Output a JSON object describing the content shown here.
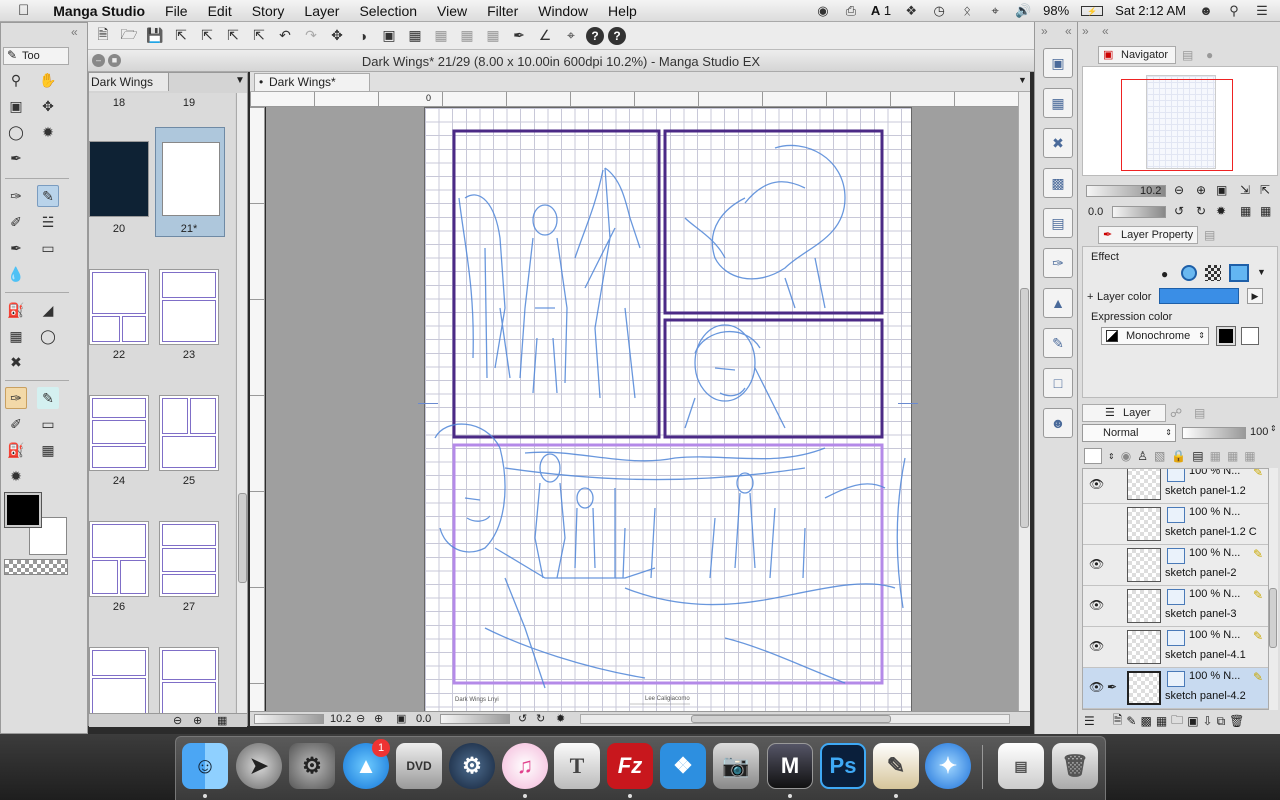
{
  "menubar": {
    "items": [
      "Manga Studio",
      "File",
      "Edit",
      "Story",
      "Layer",
      "Selection",
      "View",
      "Filter",
      "Window",
      "Help"
    ],
    "status": {
      "notifications": "1",
      "battery": "98%",
      "clock": "Sat 2:12 AM"
    }
  },
  "toolbox": {
    "title": "Too"
  },
  "story": {
    "tab": "Dark Wings",
    "pages": [
      "18",
      "19",
      "20",
      "21*",
      "22",
      "23",
      "24",
      "25",
      "26",
      "27"
    ]
  },
  "canvas": {
    "window_title": "Dark Wings* 21/29 (8.00 x 10.00in 600dpi 10.2%) - Manga Studio EX",
    "tab": "Dark Wings* 21/29",
    "ruler_zero": "0",
    "footer_left": "Dark Wings Lnyi",
    "footer_center": "Lee Caligiacomo",
    "zoom": "10.2",
    "rotation": "0.0"
  },
  "navigator": {
    "tab": "Navigator",
    "zoom": "10.2",
    "rotation": "0.0"
  },
  "layer_property": {
    "tab": "Layer Property",
    "effect_label": "Effect",
    "layer_color_label": "Layer color",
    "expression_color_label": "Expression color",
    "expression_mode": "Monochrome",
    "layer_color_hex": "#3a8ee6"
  },
  "layers": {
    "tab": "Layer",
    "blend_mode": "Normal",
    "opacity": "100",
    "rows": [
      {
        "blend": "100 % N...",
        "name": "sketch panel-1.2",
        "visible": true
      },
      {
        "blend": "100 % N...",
        "name": "sketch panel-1.2 C",
        "visible": false
      },
      {
        "blend": "100 % N...",
        "name": "sketch panel-2",
        "visible": true
      },
      {
        "blend": "100 % N...",
        "name": "sketch panel-3",
        "visible": true
      },
      {
        "blend": "100 % N...",
        "name": "sketch panel-4.1",
        "visible": true
      },
      {
        "blend": "100 % N...",
        "name": "sketch panel-4.2",
        "visible": true
      }
    ]
  },
  "dock": {
    "app_store_badge": "1"
  }
}
